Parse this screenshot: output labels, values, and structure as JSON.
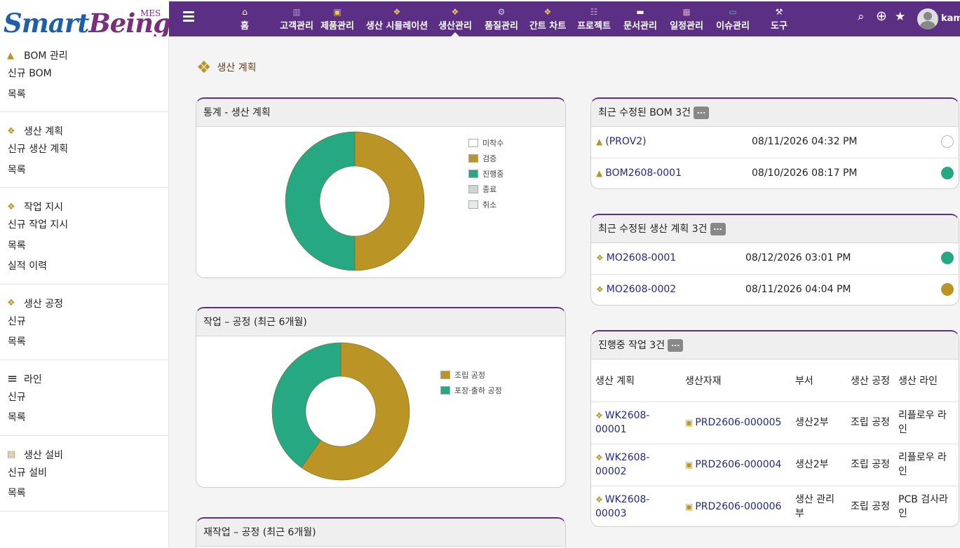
{
  "brand": {
    "logo_part1": "Smart",
    "logo_part2": "Being",
    "logo_sup": "MES"
  },
  "nav": {
    "items": [
      {
        "label": "홈",
        "icon": "home-icon"
      },
      {
        "label": "고객관리",
        "icon": "building-icon"
      },
      {
        "label": "제품관리",
        "icon": "cube-icon"
      },
      {
        "label": "생산 시뮬레이션",
        "icon": "cubes-icon"
      },
      {
        "label": "생산관리",
        "icon": "cubes-icon"
      },
      {
        "label": "품질관리",
        "icon": "cogs-icon"
      },
      {
        "label": "간트 차트",
        "icon": "cubes-icon"
      },
      {
        "label": "프로젝트",
        "icon": "sitemap-icon"
      },
      {
        "label": "문서관리",
        "icon": "folder-icon"
      },
      {
        "label": "일정관리",
        "icon": "calendar-icon"
      },
      {
        "label": "이슈관리",
        "icon": "ticket-icon"
      },
      {
        "label": "도구",
        "icon": "tools-icon"
      }
    ],
    "active": "생산관리",
    "user_name": "kame"
  },
  "sidebar": {
    "sections": [
      {
        "title": "BOM 관리",
        "icon": "shapes-icon",
        "items": [
          "신규 BOM",
          "목록"
        ]
      },
      {
        "title": "생산 계획",
        "icon": "cubes-icon",
        "items": [
          "신규 생산 계획",
          "목록"
        ]
      },
      {
        "title": "작업 지시",
        "icon": "cubes-icon",
        "items": [
          "신규 작업 지시",
          "목록",
          "실적 이력"
        ]
      },
      {
        "title": "생산 공정",
        "icon": "cubes-icon",
        "items": [
          "신규",
          "목록"
        ]
      },
      {
        "title": "라인",
        "icon": "bars-icon",
        "items": [
          "신규",
          "목록"
        ]
      },
      {
        "title": "생산 설비",
        "icon": "pallet-icon",
        "items": [
          "신규 설비",
          "목록"
        ]
      }
    ]
  },
  "page": {
    "title": "생산 계획"
  },
  "stats_card": {
    "title": "통계 - 생산 계획",
    "legend": [
      {
        "label": "미착수",
        "color": "#ffffff"
      },
      {
        "label": "검증",
        "color": "#bb9426"
      },
      {
        "label": "진행중",
        "color": "#26a882"
      },
      {
        "label": "종료",
        "color": "#cfd4d4"
      },
      {
        "label": "취소",
        "color": "#e6eaea"
      }
    ]
  },
  "chart_data": [
    {
      "type": "pie",
      "title": "통계 - 생산 계획",
      "categories": [
        "미착수",
        "검증",
        "진행중",
        "종료",
        "취소"
      ],
      "values": [
        0,
        1,
        1,
        0,
        0
      ],
      "colors": [
        "#ffffff",
        "#bb9426",
        "#26a882",
        "#cfd4d4",
        "#e6eaea"
      ],
      "legend": "right"
    },
    {
      "type": "pie",
      "title": "작업 – 공정 (최근 6개월)",
      "categories": [
        "조립 공정",
        "포장·출하 공정"
      ],
      "values": [
        2,
        1.35
      ],
      "colors": [
        "#bb9426",
        "#26a882"
      ],
      "legend": "right"
    }
  ],
  "process_card": {
    "title": "작업 – 공정 (최근 6개월)",
    "legend": [
      {
        "label": "조립 공정",
        "color": "#bb9426"
      },
      {
        "label": "포장·출하 공정",
        "color": "#26a882"
      }
    ]
  },
  "rework_card": {
    "title": "재작업 – 공정 (최근 6개월)"
  },
  "recent_bom": {
    "title": "최근 수정된 BOM 3건",
    "more": "...",
    "rows": [
      {
        "id": "(PROV2)",
        "date": "08/11/2026 04:32 PM",
        "status_color": "#ffffff"
      },
      {
        "id": "BOM2608-0001",
        "date": "08/10/2026 08:17 PM",
        "status_color": "#26a882"
      }
    ]
  },
  "recent_plans": {
    "title": "최근 수정된 생산 계획 3건",
    "more": "...",
    "rows": [
      {
        "id": "MO2608-0001",
        "date": "08/12/2026 03:01 PM",
        "status_color": "#26a882"
      },
      {
        "id": "MO2608-0002",
        "date": "08/11/2026 04:04 PM",
        "status_color": "#bb9426"
      }
    ]
  },
  "in_progress": {
    "title": "진행중 작업 3건",
    "more": "...",
    "columns": [
      "생산 계획",
      "생산자재",
      "부서",
      "생산 공정",
      "생산 라인"
    ],
    "rows": [
      {
        "plan": "WK2608-00001",
        "material": "PRD2606-000005",
        "dept": "생산2부",
        "process": "조립 공정",
        "line": "리플로우 라인"
      },
      {
        "plan": "WK2608-00002",
        "material": "PRD2606-000004",
        "dept": "생산2부",
        "process": "조립 공정",
        "line": "리플로우 라인"
      },
      {
        "plan": "WK2608-00003",
        "material": "PRD2606-000006",
        "dept": "생산 관리부",
        "process": "조립 공정",
        "line": "PCB 검사라인"
      }
    ]
  }
}
